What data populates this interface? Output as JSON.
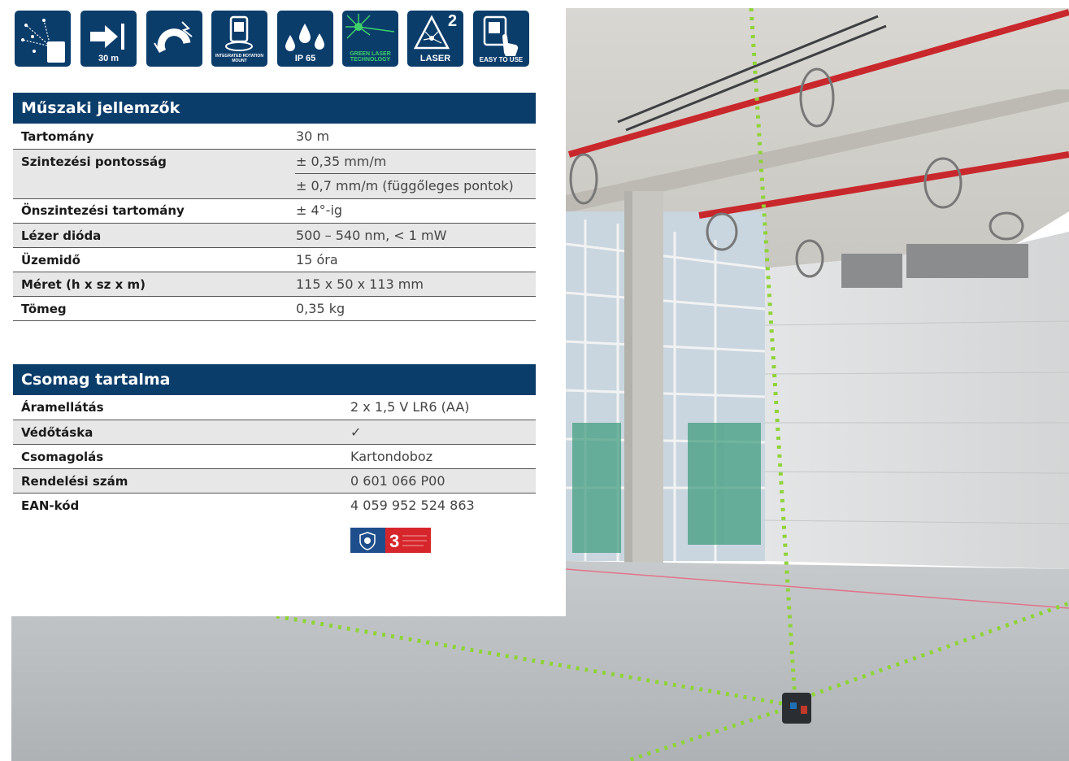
{
  "icons": [
    {
      "name": "laser-points-icon",
      "caption": ""
    },
    {
      "name": "range-icon",
      "caption": "30 m"
    },
    {
      "name": "magnet-icon",
      "caption": ""
    },
    {
      "name": "rotation-mount-icon",
      "caption": "INTEGRATED ROTATION MOUNT"
    },
    {
      "name": "ip65-icon",
      "caption": "IP 65"
    },
    {
      "name": "green-laser-icon",
      "caption": "GREEN LASER TECHNOLOGY"
    },
    {
      "name": "laser-class-icon",
      "caption": "LASER",
      "superscript": "2"
    },
    {
      "name": "easy-to-use-icon",
      "caption": "EASY TO USE"
    }
  ],
  "specs": {
    "title": "Műszaki jellemzők",
    "rows": [
      {
        "label": "Tartomány",
        "value": "30 m"
      },
      {
        "label": "Szintezési pontosság",
        "value": "± 0,35 mm/m"
      },
      {
        "label": "",
        "value": "± 0,7 mm/m (függőleges pontok)"
      },
      {
        "label": "Önszintezési tartomány",
        "value": "± 4°-ig"
      },
      {
        "label": "Lézer dióda",
        "value": "500 – 540 nm, < 1 mW"
      },
      {
        "label": "Üzemidő",
        "value": "15 óra"
      },
      {
        "label": "Méret (h x sz x m)",
        "value": "115 x 50 x 113 mm"
      },
      {
        "label": "Tömeg",
        "value": "0,35 kg"
      }
    ]
  },
  "package": {
    "title": "Csomag tartalma",
    "rows": [
      {
        "label": "Áramellátás",
        "value": "2 x 1,5 V LR6 (AA)"
      },
      {
        "label": "Védőtáska",
        "value": "✓"
      },
      {
        "label": "Csomagolás",
        "value": "Kartondoboz"
      },
      {
        "label": "Rendelési szám",
        "value": "0 601 066 P00"
      },
      {
        "label": "EAN-kód",
        "value": "4 059 952 524 863"
      }
    ]
  },
  "badge": {
    "number": "3"
  },
  "colors": {
    "navy": "#0b3d6b",
    "green_laser": "#8fd33a",
    "check": "#3eb54a",
    "pipe_red": "#c8282c"
  }
}
